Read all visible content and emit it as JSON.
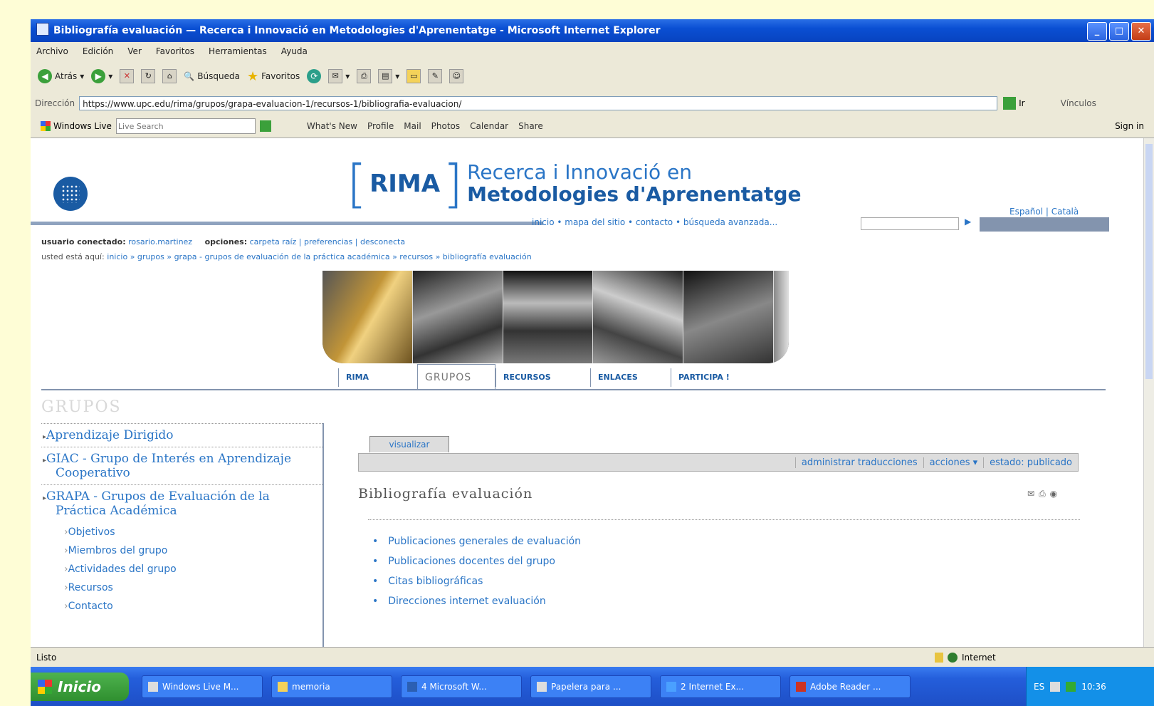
{
  "window": {
    "title": "Bibliografía evaluación — Recerca i Innovació en Metodologies d'Aprenentatge - Microsoft Internet Explorer"
  },
  "menu": [
    "Archivo",
    "Edición",
    "Ver",
    "Favoritos",
    "Herramientas",
    "Ayuda"
  ],
  "toolbar": {
    "back": "Atrás",
    "search": "Búsqueda",
    "favorites": "Favoritos"
  },
  "address": {
    "label": "Dirección",
    "url": "https://www.upc.edu/rima/grupos/grapa-evaluacion-1/recursos-1/bibliografia-evaluacion/",
    "go": "Ir",
    "links": "Vínculos"
  },
  "live": {
    "label": "Windows Live",
    "placeholder": "Live Search",
    "links": [
      "What's New",
      "Profile",
      "Mail",
      "Photos",
      "Calendar",
      "Share"
    ],
    "signin": "Sign in"
  },
  "site": {
    "brand": "RIMA",
    "tagline1": "Recerca i Innovació en",
    "tagline2": "Metodologies d'Aprenentatge",
    "langs": "Español | Català",
    "navlinks": "inicio • mapa del sitio • contacto • búsqueda avanzada...",
    "user_label": "usuario conectado:",
    "user_name": "rosario.martinez",
    "options_label": "opciones:",
    "options": "carpeta raíz | preferencias | desconecta",
    "crumb_label": "usted está aquí:",
    "crumbs": "inicio » grupos » grapa - grupos de evaluación de la práctica académica » recursos » bibliografía evaluación"
  },
  "tabs": [
    "RIMA",
    "GRUPOS",
    "RECURSOS",
    "ENLACES",
    "PARTICIPA !"
  ],
  "sidebar": {
    "heading": "GRUPOS",
    "groups": [
      "Aprendizaje Dirigido",
      "GIAC - Grupo de Interés en Aprendizaje Cooperativo",
      "GRAPA - Grupos de Evaluación de la Práctica Académica"
    ],
    "subs": [
      "Objetivos",
      "Miembros del grupo",
      "Actividades del grupo",
      "Recursos",
      "Contacto"
    ]
  },
  "doc": {
    "view_tab": "visualizar",
    "actions": [
      "administrar traducciones",
      "acciones ▾",
      "estado: publicado"
    ],
    "title": "Bibliografía evaluación",
    "items": [
      "Publicaciones generales de evaluación",
      "Publicaciones docentes del grupo",
      "Citas bibliográficas",
      "Direcciones internet evaluación"
    ]
  },
  "status": {
    "text": "Listo",
    "zone": "Internet"
  },
  "taskbar": {
    "start": "Inicio",
    "tasks": [
      "Windows Live M...",
      "memoria",
      "4 Microsoft W...",
      "Papelera para ...",
      "2 Internet Ex...",
      "Adobe Reader ..."
    ],
    "lang": "ES",
    "clock": "10:36"
  }
}
